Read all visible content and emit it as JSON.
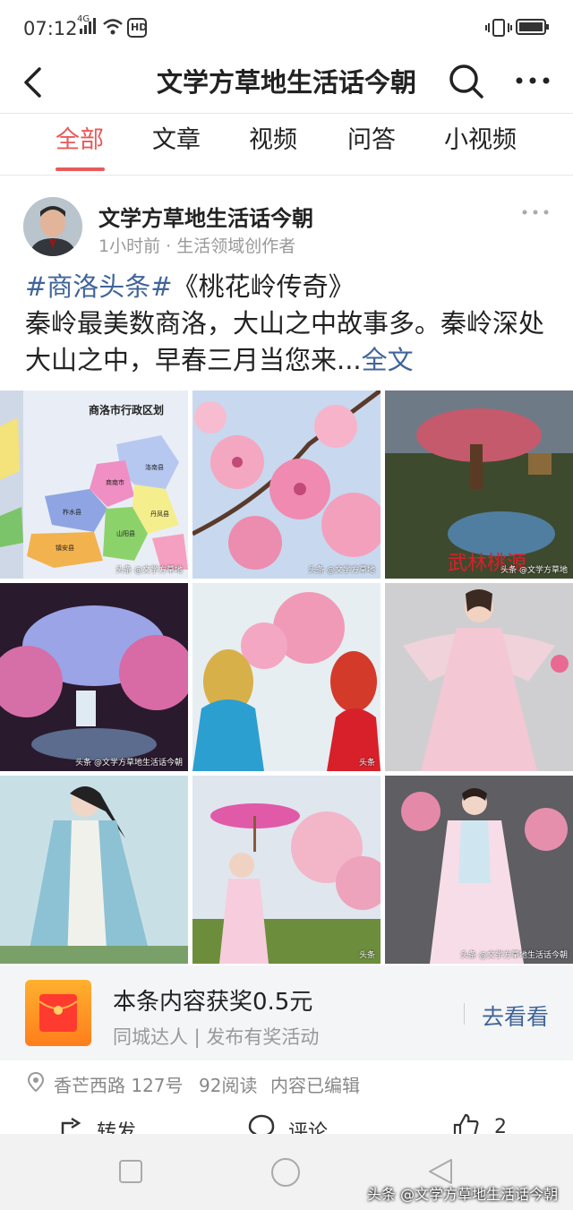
{
  "status": {
    "time": "07:12",
    "network": "4G",
    "hd": "HD"
  },
  "topbar": {
    "title": "文学方草地生活话今朝"
  },
  "tabs": [
    {
      "label": "全部",
      "active": true
    },
    {
      "label": "文章"
    },
    {
      "label": "视频"
    },
    {
      "label": "问答"
    },
    {
      "label": "小视频"
    }
  ],
  "post": {
    "author": "文学方草地生活话今朝",
    "meta": "1小时前 · 生活领域创作者",
    "hashtag": "#商洛头条#",
    "title": "《桃花岭传奇》",
    "body": "秦岭最美数商洛，大山之中故事多。秦岭深处大山之中，早春三月当您来...",
    "fulltext_link": "全文"
  },
  "images": [
    {
      "icon": "map-image",
      "heading": "商洛市行政区划",
      "districts": [
        "洛南县",
        "商南市",
        "丹凤县",
        "柞水县",
        "山阳县",
        "镇安县"
      ],
      "watermark": "头条 @文学方草地"
    },
    {
      "icon": "peach-blossom-image",
      "watermark": "头条 @文学方草地"
    },
    {
      "icon": "fantasy-tree-image",
      "caption": "武林桃源",
      "watermark": "头条 @文学方草地"
    },
    {
      "icon": "waterfall-blossom-image",
      "watermark": "头条 @文学方草地生活话今朝"
    },
    {
      "icon": "veiled-women-image",
      "watermark": "头条"
    },
    {
      "icon": "pink-dress-woman-image"
    },
    {
      "icon": "swordsman-image"
    },
    {
      "icon": "parasol-girl-image",
      "watermark": "头条"
    },
    {
      "icon": "hanfu-girl-image",
      "watermark": "头条 @文学方草地生活话今朝"
    }
  ],
  "reward": {
    "title": "本条内容获奖0.5元",
    "subtitle": "同城达人 | 发布有奖活动",
    "cta": "去看看"
  },
  "meta_row": {
    "location": "香芒西路 127号",
    "reads": "92阅读",
    "edited": "内容已编辑"
  },
  "actions": {
    "share": "转发",
    "comment": "评论",
    "like_count": "2"
  },
  "watermark": "头条 @文学方草地生活话今朝",
  "colors": {
    "accent": "#e85a5a",
    "link": "#406599",
    "reward": "#ff8a22"
  }
}
